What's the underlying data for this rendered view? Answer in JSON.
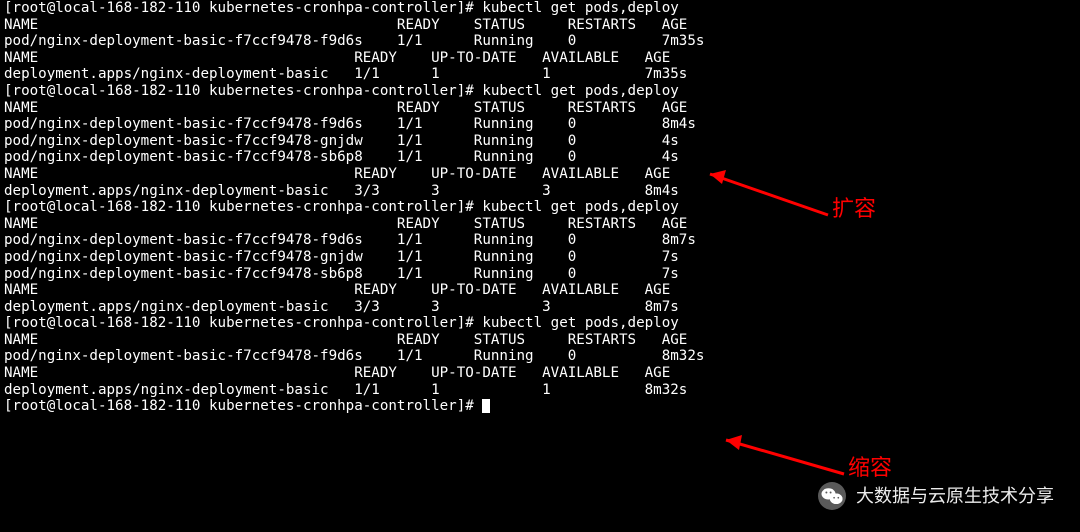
{
  "blocks": [
    {
      "prompt": "[root@local-168-182-110 kubernetes-cronhpa-controller]# ",
      "cmd": "kubectl get pods,deploy",
      "pods": {
        "header": [
          "NAME",
          "READY",
          "STATUS",
          "RESTARTS",
          "AGE"
        ],
        "rows": [
          [
            "pod/nginx-deployment-basic-f7ccf9478-f9d6s",
            "1/1",
            "Running",
            "0",
            "7m35s"
          ]
        ]
      },
      "deploy": {
        "header": [
          "NAME",
          "READY",
          "UP-TO-DATE",
          "AVAILABLE",
          "AGE"
        ],
        "rows": [
          [
            "deployment.apps/nginx-deployment-basic",
            "1/1",
            "1",
            "1",
            "7m35s"
          ]
        ]
      }
    },
    {
      "prompt": "[root@local-168-182-110 kubernetes-cronhpa-controller]# ",
      "cmd": "kubectl get pods,deploy",
      "pods": {
        "header": [
          "NAME",
          "READY",
          "STATUS",
          "RESTARTS",
          "AGE"
        ],
        "rows": [
          [
            "pod/nginx-deployment-basic-f7ccf9478-f9d6s",
            "1/1",
            "Running",
            "0",
            "8m4s"
          ],
          [
            "pod/nginx-deployment-basic-f7ccf9478-gnjdw",
            "1/1",
            "Running",
            "0",
            "4s"
          ],
          [
            "pod/nginx-deployment-basic-f7ccf9478-sb6p8",
            "1/1",
            "Running",
            "0",
            "4s"
          ]
        ]
      },
      "deploy": {
        "header": [
          "NAME",
          "READY",
          "UP-TO-DATE",
          "AVAILABLE",
          "AGE"
        ],
        "rows": [
          [
            "deployment.apps/nginx-deployment-basic",
            "3/3",
            "3",
            "3",
            "8m4s"
          ]
        ]
      }
    },
    {
      "prompt": "[root@local-168-182-110 kubernetes-cronhpa-controller]# ",
      "cmd": "kubectl get pods,deploy",
      "pods": {
        "header": [
          "NAME",
          "READY",
          "STATUS",
          "RESTARTS",
          "AGE"
        ],
        "rows": [
          [
            "pod/nginx-deployment-basic-f7ccf9478-f9d6s",
            "1/1",
            "Running",
            "0",
            "8m7s"
          ],
          [
            "pod/nginx-deployment-basic-f7ccf9478-gnjdw",
            "1/1",
            "Running",
            "0",
            "7s"
          ],
          [
            "pod/nginx-deployment-basic-f7ccf9478-sb6p8",
            "1/1",
            "Running",
            "0",
            "7s"
          ]
        ]
      },
      "deploy": {
        "header": [
          "NAME",
          "READY",
          "UP-TO-DATE",
          "AVAILABLE",
          "AGE"
        ],
        "rows": [
          [
            "deployment.apps/nginx-deployment-basic",
            "3/3",
            "3",
            "3",
            "8m7s"
          ]
        ]
      }
    },
    {
      "prompt": "[root@local-168-182-110 kubernetes-cronhpa-controller]# ",
      "cmd": "kubectl get pods,deploy",
      "pods": {
        "header": [
          "NAME",
          "READY",
          "STATUS",
          "RESTARTS",
          "AGE"
        ],
        "rows": [
          [
            "pod/nginx-deployment-basic-f7ccf9478-f9d6s",
            "1/1",
            "Running",
            "0",
            "8m32s"
          ]
        ]
      },
      "deploy": {
        "header": [
          "NAME",
          "READY",
          "UP-TO-DATE",
          "AVAILABLE",
          "AGE"
        ],
        "rows": [
          [
            "deployment.apps/nginx-deployment-basic",
            "1/1",
            "1",
            "1",
            "8m32s"
          ]
        ]
      }
    }
  ],
  "final_prompt": "[root@local-168-182-110 kubernetes-cronhpa-controller]# ",
  "labels": {
    "scale_up": "扩容",
    "scale_down": "缩容"
  },
  "footer": "大数据与云原生技术分享",
  "cols": {
    "podName": 46,
    "ready": 9,
    "status": 11,
    "restarts": 11,
    "depName": 41,
    "depReady": 9,
    "upToDate": 13,
    "available": 12
  }
}
